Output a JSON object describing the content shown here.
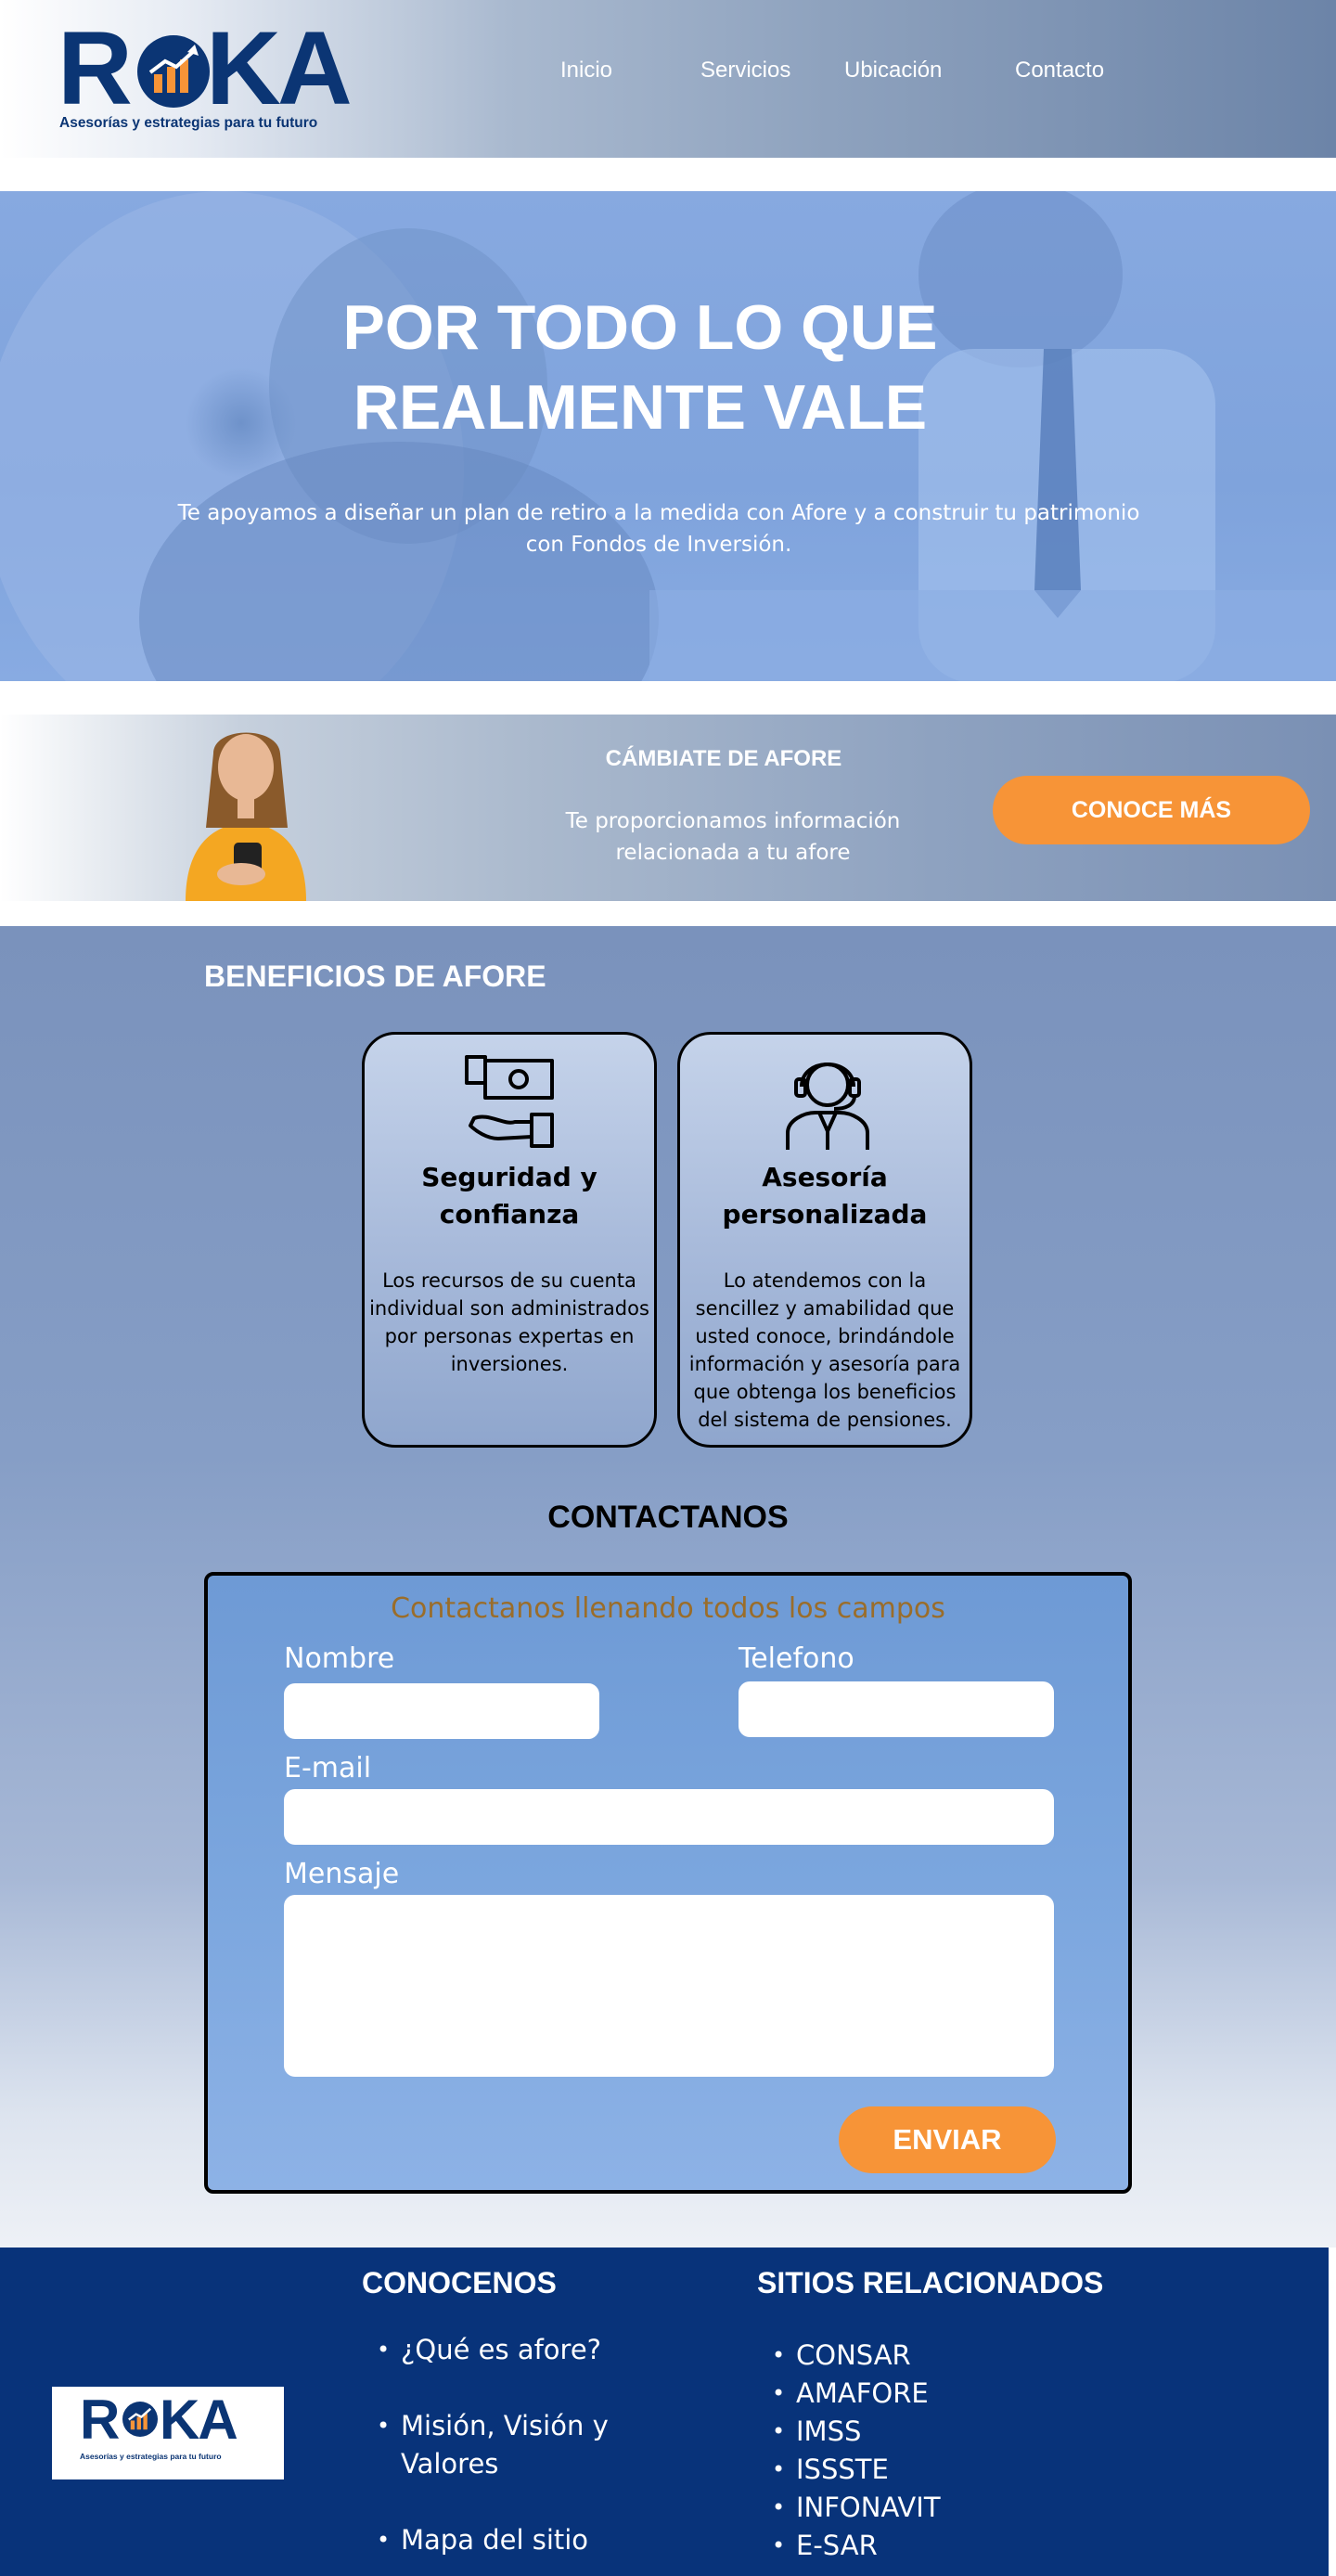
{
  "header": {
    "logo_text": "ROKA",
    "logo_tagline": "Asesorías y estrategias para tu futuro",
    "nav": [
      "Inicio",
      "Servicios",
      "Ubicación",
      "Contacto"
    ]
  },
  "hero": {
    "title": "POR TODO LO QUE REALMENTE VALE",
    "subtitle": "Te apoyamos a diseñar un plan de retiro a la medida con Afore y a construir tu patrimonio con Fondos de Inversión."
  },
  "banner": {
    "title": "CÁMBIATE DE AFORE",
    "text": "Te proporcionamos información relacionada a tu afore",
    "button": "CONOCE MÁS"
  },
  "benefits": {
    "title": "BENEFICIOS DE AFORE",
    "cards": [
      {
        "icon": "money-hand-icon",
        "title": "Seguridad y confianza",
        "text": "Los recursos de su cuenta individual son administrados por personas expertas en inversiones."
      },
      {
        "icon": "support-agent-icon",
        "title": "Asesoría personalizada",
        "text": "Lo atendemos con la sencillez y amabilidad que usted conoce, brindándole información y asesoría para que obtenga los beneficios del sistema de pensiones."
      }
    ]
  },
  "contact": {
    "title": "CONTACTANOS",
    "form_heading": "Contactanos llenando todos los campos",
    "labels": {
      "name": "Nombre",
      "phone": "Telefono",
      "email": "E-mail",
      "message": "Mensaje"
    },
    "values": {
      "name": "",
      "phone": "",
      "email": "",
      "message": ""
    },
    "submit": "ENVIAR"
  },
  "footer": {
    "logo_text": "ROKA",
    "logo_tagline": "Asesorías y estrategias para tu futuro",
    "col1_title": "CONOCENOS",
    "col1_items": [
      "¿Qué es afore?",
      "Misión, Visión y Valores",
      "Mapa del sitio"
    ],
    "col2_title": "SITIOS RELACIONADOS",
    "col2_items": [
      "CONSAR",
      "AMAFORE",
      "IMSS",
      "ISSSTE",
      "INFONAVIT",
      "E-SAR"
    ]
  },
  "colors": {
    "brand_navy": "#0b3574",
    "accent_orange": "#f79437",
    "footer_bg": "#08337a",
    "form_heading": "#9a6d2a"
  }
}
